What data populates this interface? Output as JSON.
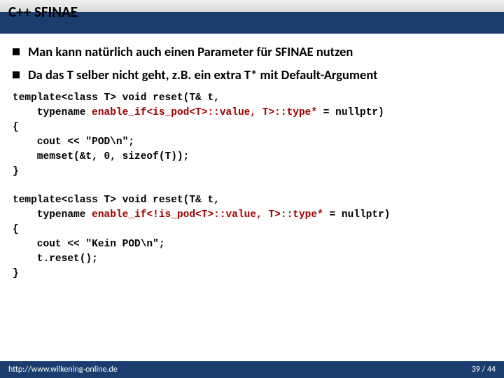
{
  "title": "C++ SFINAE",
  "bullets": [
    "Man kann natürlich auch einen Parameter für SFINAE nutzen",
    "Da das T selber nicht geht, z.B. ein extra T* mit Default-Argument"
  ],
  "code1": {
    "l1a": "template<class T> void reset(T& t,",
    "l2a": "    typename ",
    "l2b": "enable_if<is_pod<T>::value, T>::type*",
    "l2c": " = nullptr)",
    "l3": "{",
    "l4": "    cout << \"POD\\n\";",
    "l5": "    memset(&t, 0, sizeof(T));",
    "l6": "}"
  },
  "code2": {
    "l1a": "template<class T> void reset(T& t,",
    "l2a": "    typename ",
    "l2b": "enable_if<!is_pod<T>::value, T>::type*",
    "l2c": " = nullptr)",
    "l3": "{",
    "l4": "    cout << \"Kein POD\\n\";",
    "l5": "    t.reset();",
    "l6": "}"
  },
  "footer": {
    "url": "http://www.wilkening-online.de",
    "page": "39 / 44"
  }
}
